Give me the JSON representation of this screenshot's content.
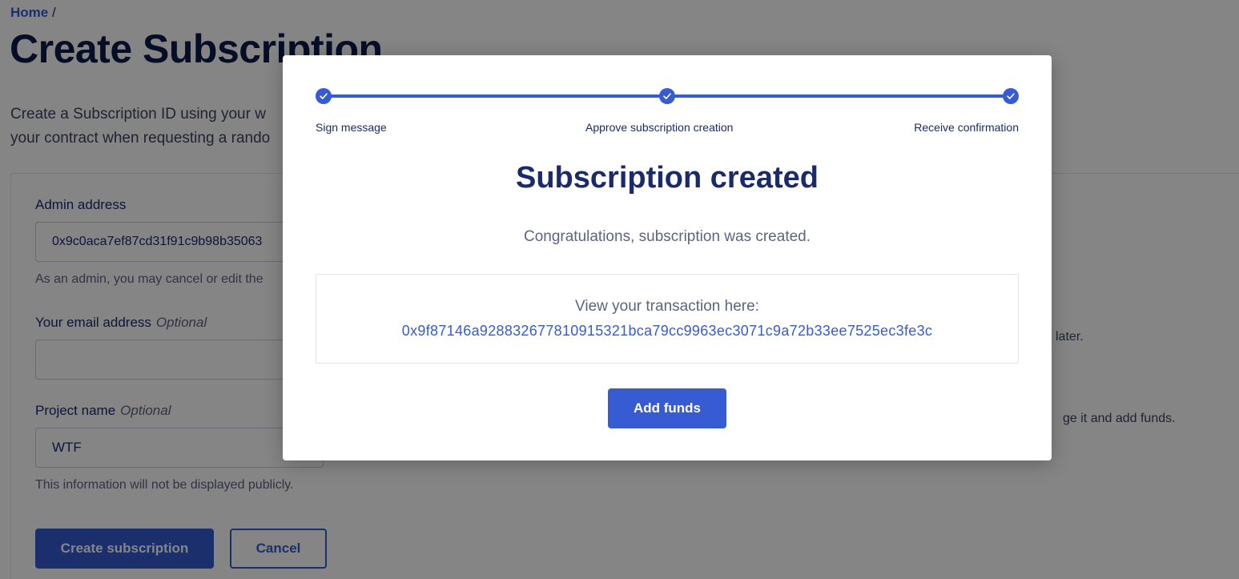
{
  "breadcrumb": {
    "home": "Home",
    "separator": "/"
  },
  "page": {
    "title": "Create Subscription",
    "intro_line1": "Create a Subscription ID using your w",
    "intro_line2": "your contract when requesting a rando"
  },
  "form": {
    "admin_label": "Admin address",
    "admin_value": "0x9c0aca7ef87cd31f91c9b98b35063",
    "admin_help": "As an admin, you may cancel or edit the",
    "email_label": "Your email address",
    "email_optional": "Optional",
    "email_value": "",
    "project_label": "Project name",
    "project_optional": "Optional",
    "project_value": "WTF",
    "project_help": "This information will not be displayed publicly.",
    "create_button": "Create subscription",
    "cancel_button": "Cancel"
  },
  "right_panel": {
    "text1": "later.",
    "text2": "ge it and add funds."
  },
  "modal": {
    "steps": [
      {
        "label": "Sign message",
        "status": "complete"
      },
      {
        "label": "Approve subscription creation",
        "status": "complete"
      },
      {
        "label": "Receive confirmation",
        "status": "complete"
      }
    ],
    "title": "Subscription created",
    "message": "Congratulations, subscription was created.",
    "tx_label": "View your transaction here:",
    "tx_hash": "0x9f87146a9288326778109153​21bca79cc9963ec3071c9a72b33ee7525ec3fe3c",
    "add_funds_button": "Add funds"
  },
  "colors": {
    "accent": "#375bd2",
    "title": "#1a2b6b",
    "overlay": "rgba(0,0,0,0.48)"
  }
}
